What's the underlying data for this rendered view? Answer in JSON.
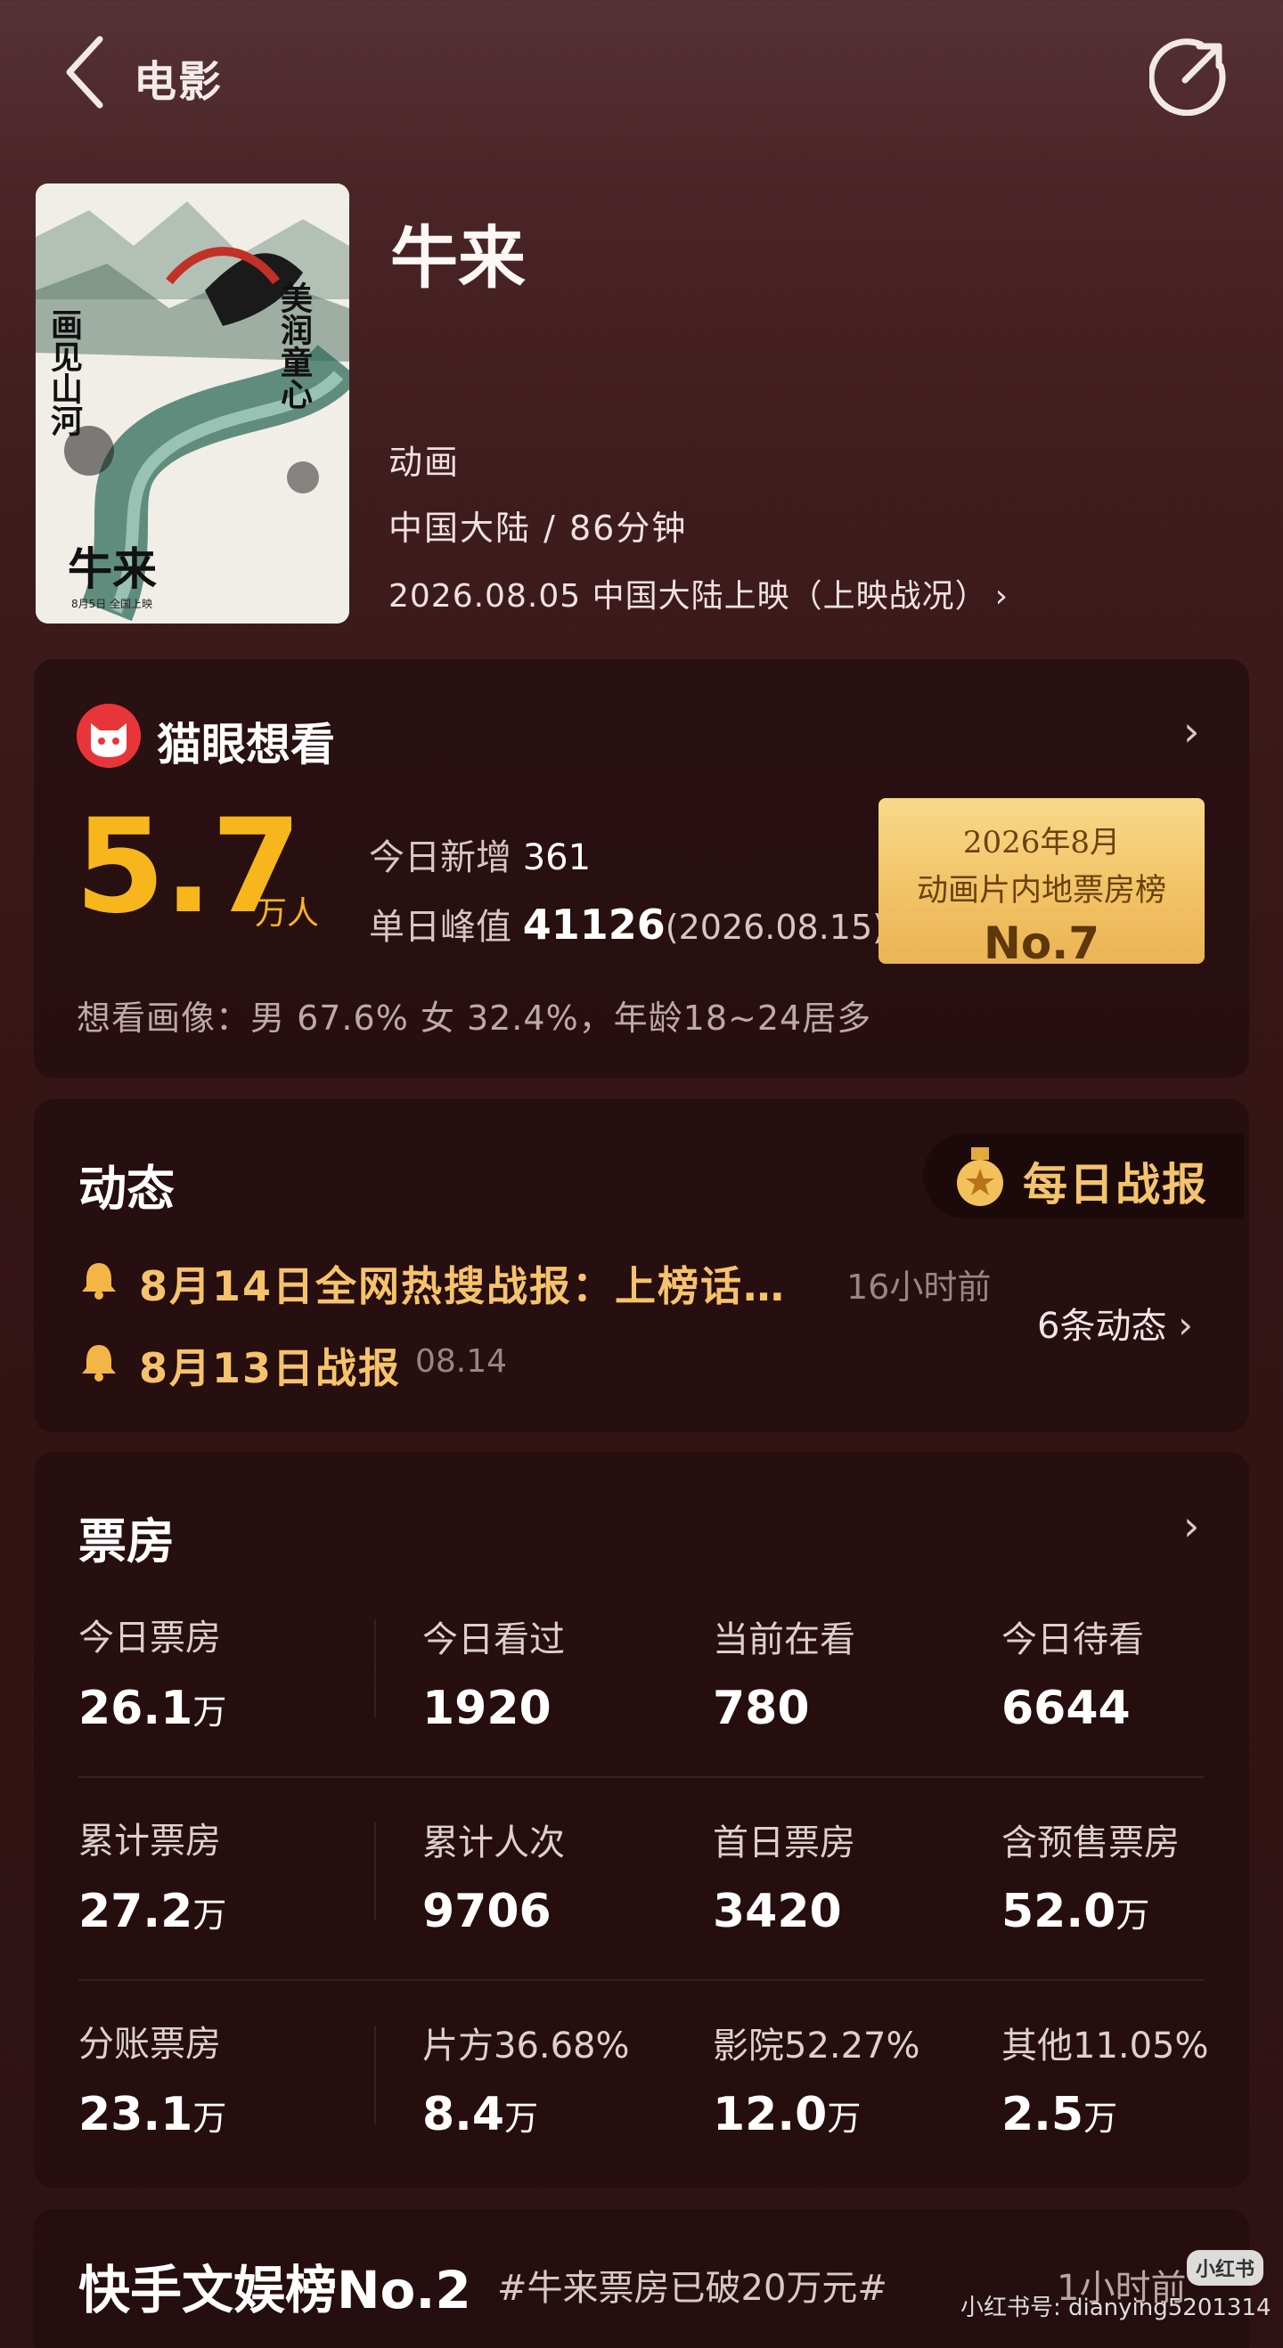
{
  "header": {
    "title": "电影",
    "back_icon": "chevron-left-icon",
    "share_icon": "share-icon"
  },
  "movie": {
    "title": "牛来",
    "genre": "动画",
    "region_duration": "中国大陆 / 86分钟",
    "release": "2026.08.05 中国大陆上映（上映战况）",
    "release_chevron": "›",
    "poster_text": {
      "left": "画见山河",
      "right": "美润童心",
      "name": "牛来",
      "date": "8月5日 全国上映"
    }
  },
  "maoyan": {
    "title": "猫眼想看",
    "chevron": "›",
    "want_value": "5.7",
    "want_unit": "万人",
    "today_add_label": "今日新增",
    "today_add_value": "361",
    "peak_label": "单日峰值",
    "peak_value": "41126",
    "peak_date": "(2026.08.15)",
    "rank": {
      "line1": "2026年8月",
      "line2": "动画片内地票房榜",
      "line3": "No.7"
    },
    "portrait": "想看画像：男 67.6%  女 32.4%，年龄18~24居多"
  },
  "dynamics": {
    "title": "动态",
    "daily_report": "每日战报",
    "items": [
      {
        "text": "8月14日全网热搜战报：上榜话…",
        "time": "16小时前"
      },
      {
        "text": "8月13日战报",
        "time": "08.14"
      }
    ],
    "count_label": "6条动态",
    "chevron": "›"
  },
  "box_office": {
    "title": "票房",
    "chevron": "›",
    "rows": [
      [
        {
          "label": "今日票房",
          "value": "26.1",
          "unit": "万"
        },
        {
          "label": "今日看过",
          "value": "1920",
          "unit": ""
        },
        {
          "label": "当前在看",
          "value": "780",
          "unit": ""
        },
        {
          "label": "今日待看",
          "value": "6644",
          "unit": ""
        }
      ],
      [
        {
          "label": "累计票房",
          "value": "27.2",
          "unit": "万"
        },
        {
          "label": "累计人次",
          "value": "9706",
          "unit": ""
        },
        {
          "label": "首日票房",
          "value": "3420",
          "unit": ""
        },
        {
          "label": "含预售票房",
          "value": "52.0",
          "unit": "万"
        }
      ],
      [
        {
          "label": "分账票房",
          "value": "23.1",
          "unit": "万"
        },
        {
          "label": "片方36.68%",
          "value": "8.4",
          "unit": "万"
        },
        {
          "label": "影院52.27%",
          "value": "12.0",
          "unit": "万"
        },
        {
          "label": "其他11.05%",
          "value": "2.5",
          "unit": "万"
        }
      ]
    ]
  },
  "kuaishou": {
    "title": "快手文娱榜No.2",
    "tag": "#牛来票房已破20万元#",
    "time": "1小时前"
  },
  "watermark": {
    "logo": "小红书",
    "text": "小红书号: dianying5201314"
  },
  "colors": {
    "accent_gold": "#f7b71c",
    "news_gold": "#f6c36c",
    "maoyan_red": "#e8353a"
  }
}
